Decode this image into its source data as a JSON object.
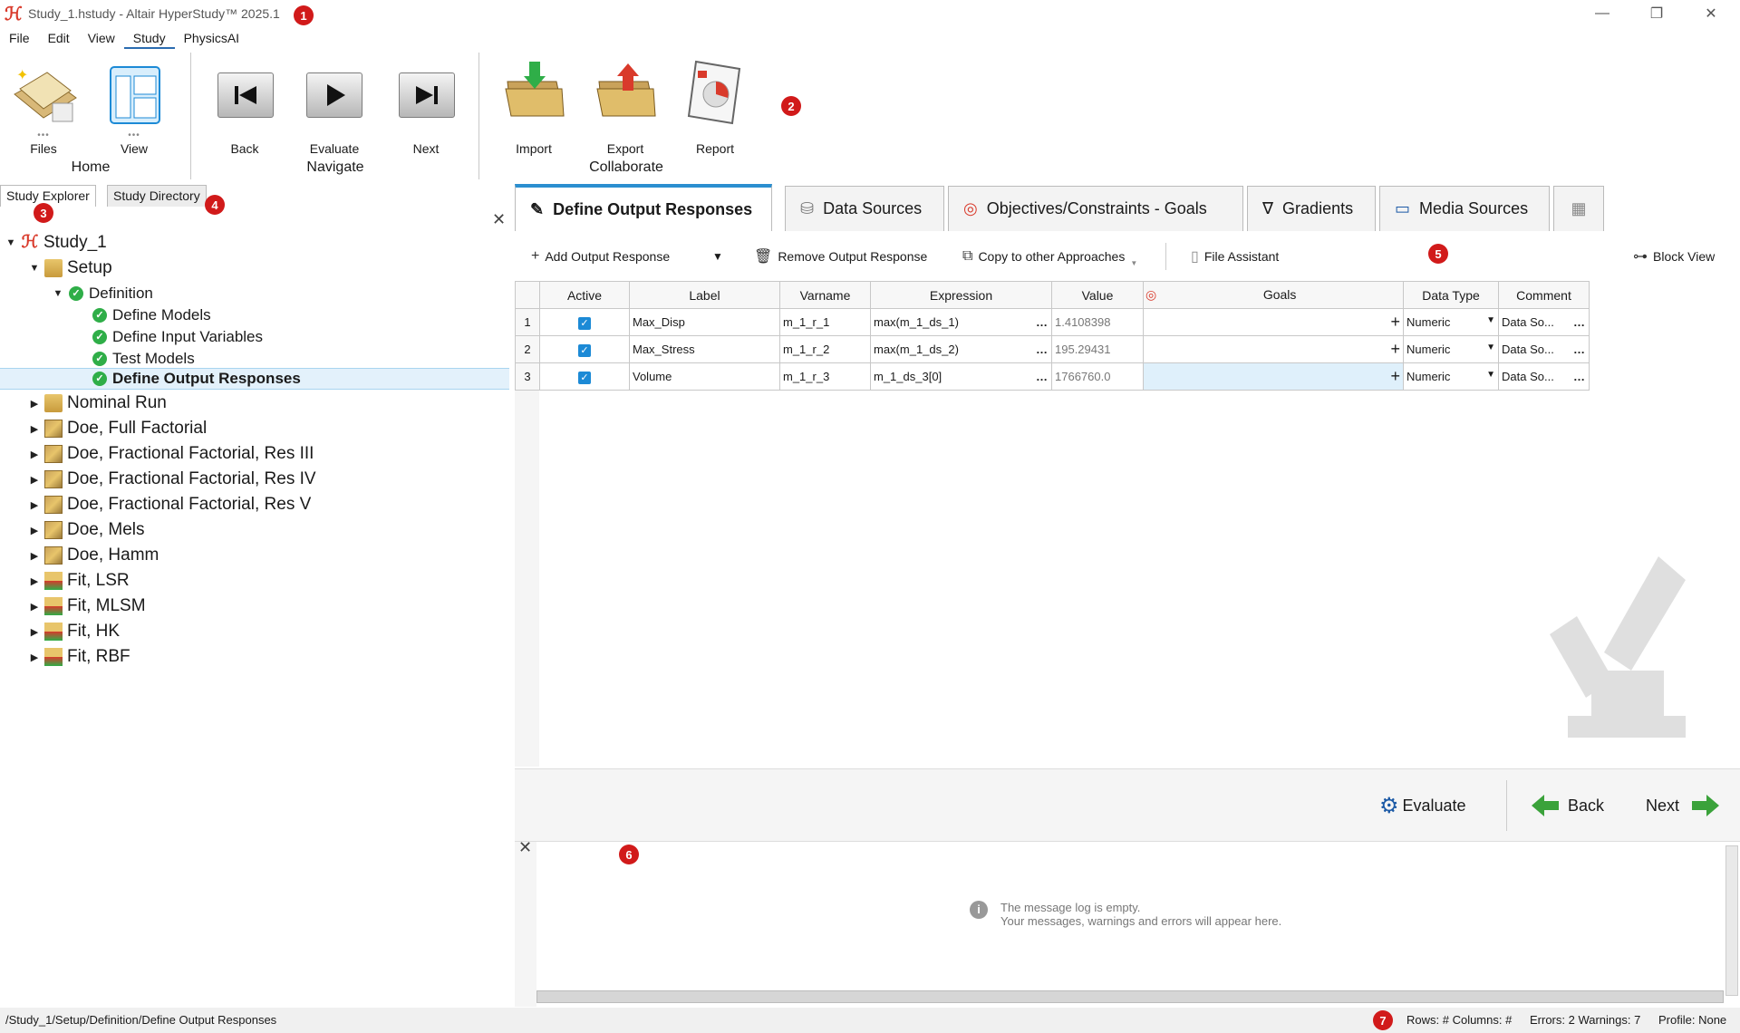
{
  "window": {
    "title": "Study_1.hstudy - Altair HyperStudy™ 2025.1"
  },
  "menu": [
    "File",
    "Edit",
    "View",
    "Study",
    "PhysicsAI"
  ],
  "ribbon": {
    "files": "Files",
    "view": "View",
    "home_group": "Home",
    "back": "Back",
    "evaluate": "Evaluate",
    "next": "Next",
    "navigate_group": "Navigate",
    "import": "Import",
    "export": "Export",
    "report": "Report",
    "collaborate_group": "Collaborate"
  },
  "badges": [
    "1",
    "2",
    "3",
    "4",
    "5",
    "6",
    "7"
  ],
  "left_tabs": {
    "explorer": "Study Explorer",
    "directory": "Study Directory"
  },
  "tree": [
    {
      "label": "Study_1",
      "level": 0
    },
    {
      "label": "Setup",
      "level": 1
    },
    {
      "label": "Definition",
      "level": 2
    },
    {
      "label": "Define Models",
      "level": 3
    },
    {
      "label": "Define Input Variables",
      "level": 3
    },
    {
      "label": "Test Models",
      "level": 3
    },
    {
      "label": "Define Output Responses",
      "level": 3
    },
    {
      "label": "Nominal Run",
      "level": 1
    },
    {
      "label": "Doe, Full Factorial",
      "level": 1
    },
    {
      "label": "Doe, Fractional Factorial, Res III",
      "level": 1
    },
    {
      "label": "Doe, Fractional Factorial, Res IV",
      "level": 1
    },
    {
      "label": "Doe, Fractional Factorial, Res V",
      "level": 1
    },
    {
      "label": "Doe, Mels",
      "level": 1
    },
    {
      "label": "Doe, Hamm",
      "level": 1
    },
    {
      "label": "Fit, LSR",
      "level": 1
    },
    {
      "label": "Fit, MLSM",
      "level": 1
    },
    {
      "label": "Fit, HK",
      "level": 1
    },
    {
      "label": "Fit, RBF",
      "level": 1
    }
  ],
  "tabs": [
    "Define Output Responses",
    "Data Sources",
    "Objectives/Constraints - Goals",
    "Gradients",
    "Media Sources"
  ],
  "toolbar": {
    "add": "Add Output Response",
    "remove": "Remove Output Response",
    "copy": "Copy to other Approaches",
    "file_assistant": "File Assistant",
    "block_view": "Block View"
  },
  "table": {
    "headers": [
      "Active",
      "Label",
      "Varname",
      "Expression",
      "Value",
      "Goals",
      "Data Type",
      "Comment"
    ],
    "rows": [
      {
        "n": "1",
        "label": "Max_Disp",
        "varname": "m_1_r_1",
        "expr": "max(m_1_ds_1)",
        "value": "1.4108398",
        "type": "Numeric",
        "comment": "Data So..."
      },
      {
        "n": "2",
        "label": "Max_Stress",
        "varname": "m_1_r_2",
        "expr": "max(m_1_ds_2)",
        "value": "195.29431",
        "type": "Numeric",
        "comment": "Data So..."
      },
      {
        "n": "3",
        "label": "Volume",
        "varname": "m_1_r_3",
        "expr": "m_1_ds_3[0]",
        "value": "1766760.0",
        "type": "Numeric",
        "comment": "Data So..."
      }
    ]
  },
  "nav": {
    "evaluate": "Evaluate",
    "back": "Back",
    "next": "Next"
  },
  "log": {
    "line1": "The message log is empty.",
    "line2": "Your messages, warnings and errors will appear here."
  },
  "status": {
    "path": "/Study_1/Setup/Definition/Define Output Responses",
    "rowscols": "Rows: # Columns: #",
    "errors": "Errors: 2 Warnings: 7",
    "profile": "Profile: None"
  }
}
